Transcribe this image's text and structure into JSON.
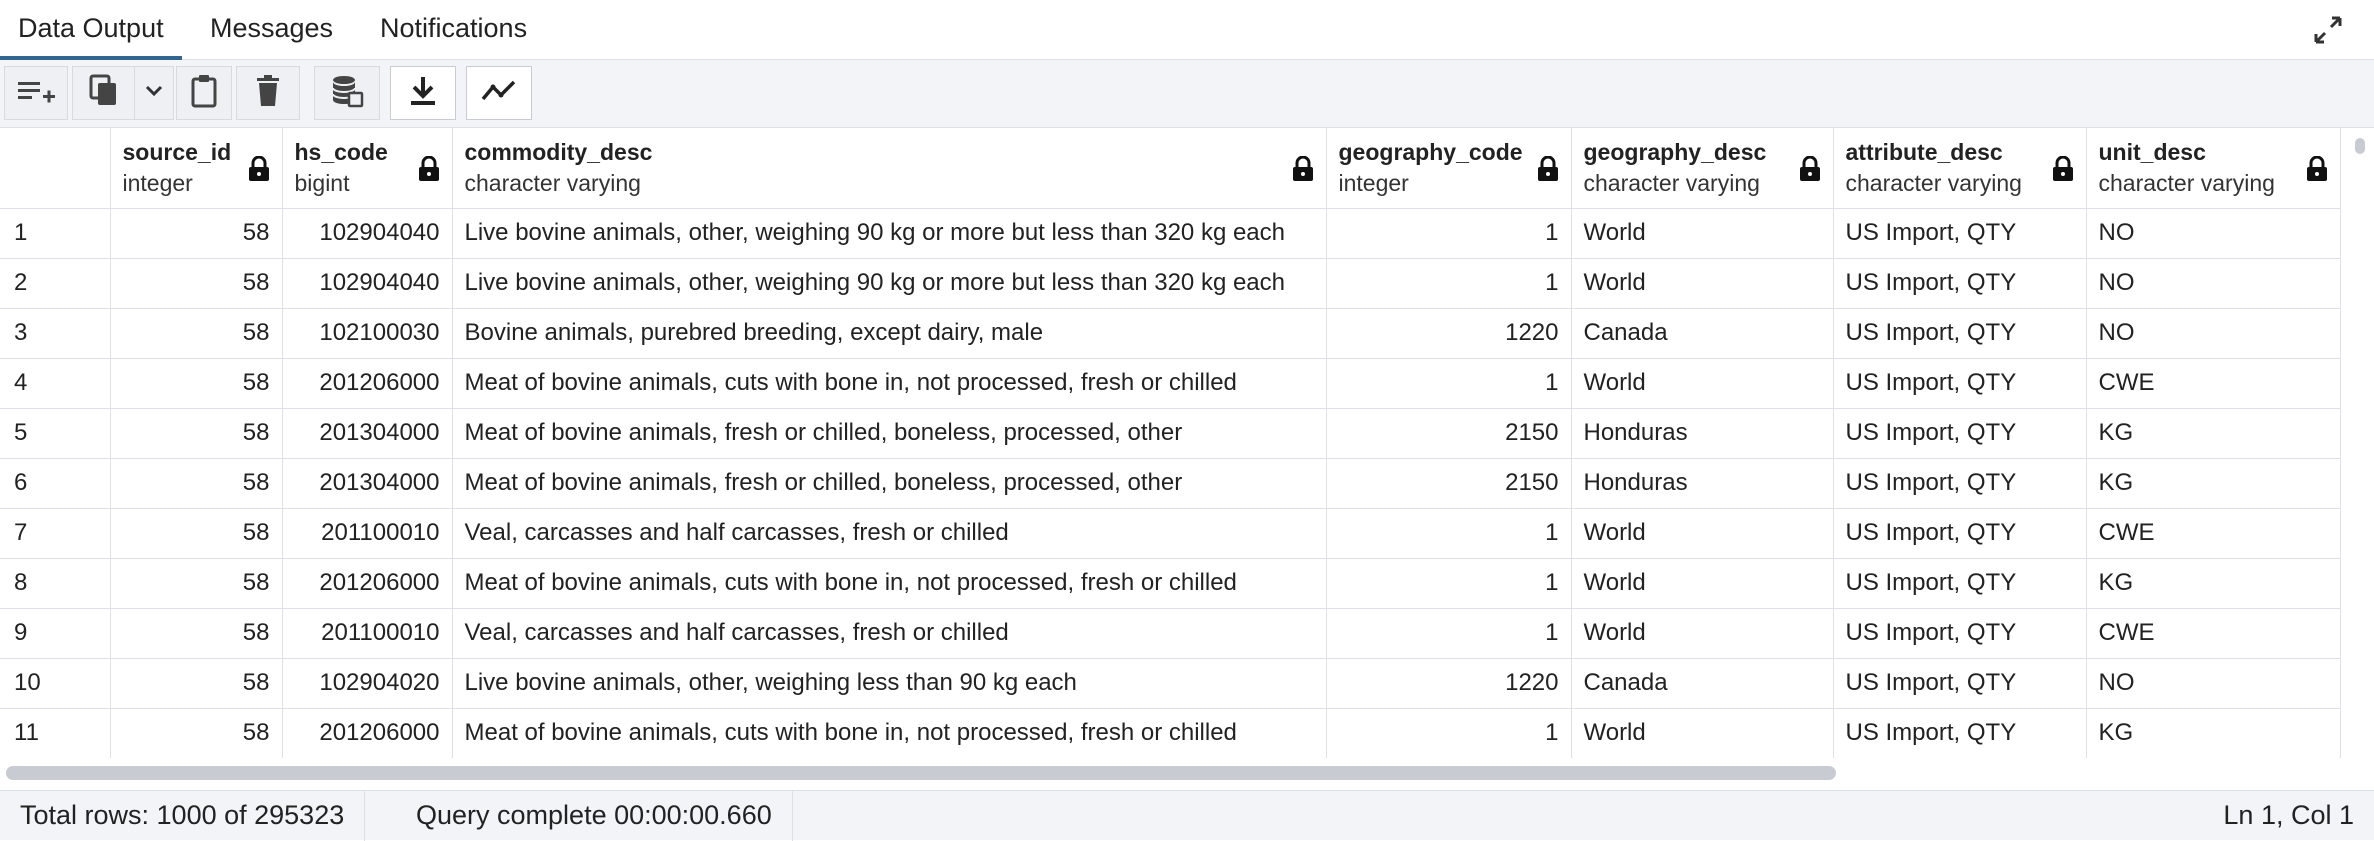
{
  "tabs": [
    {
      "label": "Data Output"
    },
    {
      "label": "Messages"
    },
    {
      "label": "Notifications"
    }
  ],
  "icons": {
    "expand": "expand-icon",
    "add_row": "add-row-icon",
    "copy": "copy-icon",
    "copy_dropdown": "chevron-down-icon",
    "paste": "paste-icon",
    "delete": "trash-icon",
    "save_data": "database-save-icon",
    "download": "download-icon",
    "graph": "line-graph-icon",
    "lock": "lock-icon"
  },
  "columns": [
    {
      "name": "source_id",
      "type": "integer"
    },
    {
      "name": "hs_code",
      "type": "bigint"
    },
    {
      "name": "commodity_desc",
      "type": "character varying"
    },
    {
      "name": "geography_code",
      "type": "integer"
    },
    {
      "name": "geography_desc",
      "type": "character varying"
    },
    {
      "name": "attribute_desc",
      "type": "character varying"
    },
    {
      "name": "unit_desc",
      "type": "character varying"
    }
  ],
  "rows": [
    [
      "1",
      "58",
      "102904040",
      "Live bovine animals, other, weighing 90 kg or more but less than 320 kg each",
      "1",
      "World",
      "US Import, QTY",
      "NO"
    ],
    [
      "2",
      "58",
      "102904040",
      "Live bovine animals, other, weighing 90 kg or more but less than 320 kg each",
      "1",
      "World",
      "US Import, QTY",
      "NO"
    ],
    [
      "3",
      "58",
      "102100030",
      "Bovine animals, purebred breeding, except dairy, male",
      "1220",
      "Canada",
      "US Import, QTY",
      "NO"
    ],
    [
      "4",
      "58",
      "201206000",
      "Meat of bovine animals, cuts with bone in, not processed, fresh or chilled",
      "1",
      "World",
      "US Import, QTY",
      "CWE"
    ],
    [
      "5",
      "58",
      "201304000",
      "Meat of bovine animals, fresh or chilled, boneless, processed, other",
      "2150",
      "Honduras",
      "US Import, QTY",
      "KG"
    ],
    [
      "6",
      "58",
      "201304000",
      "Meat of bovine animals, fresh or chilled, boneless, processed, other",
      "2150",
      "Honduras",
      "US Import, QTY",
      "KG"
    ],
    [
      "7",
      "58",
      "201100010",
      "Veal, carcasses and half carcasses, fresh or chilled",
      "1",
      "World",
      "US Import, QTY",
      "CWE"
    ],
    [
      "8",
      "58",
      "201206000",
      "Meat of bovine animals, cuts with bone in, not processed, fresh or chilled",
      "1",
      "World",
      "US Import, QTY",
      "KG"
    ],
    [
      "9",
      "58",
      "201100010",
      "Veal, carcasses and half carcasses, fresh or chilled",
      "1",
      "World",
      "US Import, QTY",
      "CWE"
    ],
    [
      "10",
      "58",
      "102904020",
      "Live bovine animals, other, weighing less than 90 kg each",
      "1220",
      "Canada",
      "US Import, QTY",
      "NO"
    ],
    [
      "11",
      "58",
      "201206000",
      "Meat of bovine animals, cuts with bone in, not processed, fresh or chilled",
      "1",
      "World",
      "US Import, QTY",
      "KG"
    ]
  ],
  "status": {
    "total_rows": "Total rows: 1000 of 295323",
    "query_complete": "Query complete 00:00:00.660",
    "cursor": "Ln 1, Col 1"
  }
}
